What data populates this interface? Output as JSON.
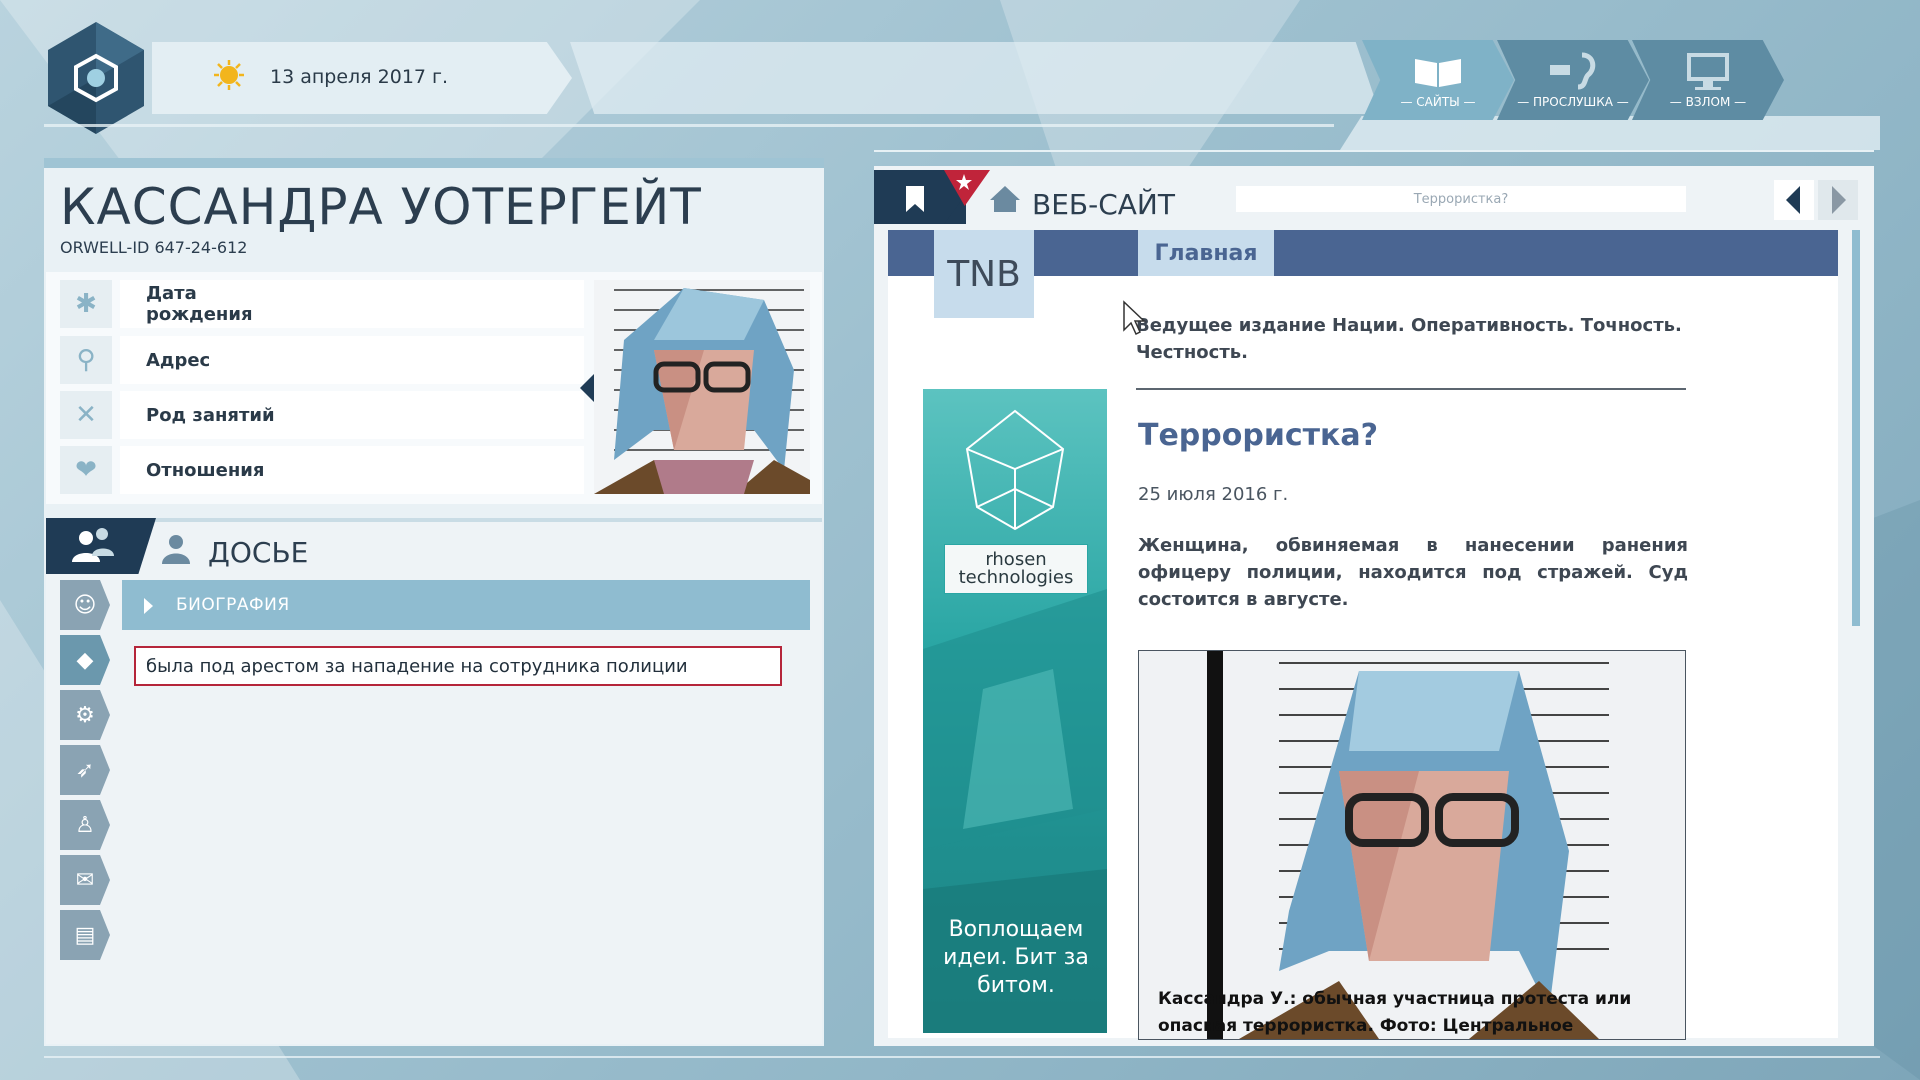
{
  "header": {
    "date": "13 апреля 2017 г.",
    "tabs": [
      {
        "label": "— САЙТЫ —",
        "icon": "book-icon",
        "active": true
      },
      {
        "label": "— ПРОСЛУШКА —",
        "icon": "ear-icon",
        "active": false
      },
      {
        "label": "— ВЗЛОМ —",
        "icon": "monitor-icon",
        "active": false
      }
    ]
  },
  "profile": {
    "name": "КАССАНДРА УОТЕРГЕЙТ",
    "orwell_id": "ORWELL-ID  647-24-612",
    "fields": [
      {
        "label": "Дата\nрождения",
        "icon": "asterisk-icon"
      },
      {
        "label": "Адрес",
        "icon": "location-pin-icon"
      },
      {
        "label": "Род занятий",
        "icon": "tools-icon"
      },
      {
        "label": "Отношения",
        "icon": "hearts-icon"
      }
    ]
  },
  "dossier": {
    "title": "ДОСЬЕ",
    "section": "БИОГРАФИЯ",
    "entry": "была под арестом за нападение на сотрудника полиции",
    "side_icons": [
      "face-icon",
      "eraser-icon",
      "gears-icon",
      "runner-icon",
      "person-icon",
      "chat-icon",
      "notebook-icon"
    ]
  },
  "browser": {
    "label": "ВЕБ-САЙТ",
    "url": "Террористка?",
    "site": {
      "logo": "TNB",
      "nav": "Главная",
      "tagline": "Ведущее издание Нации. Оперативность. Точность. Честность.",
      "headline": "Террористка?",
      "date": "25 июля 2016 г.",
      "body": "Женщина, обвиняемая в нанесении ранения офицеру полиции, находится под стражей. Суд состоится в августе.",
      "caption": "Кассандра У.: обычная участница протеста или опасная террористка. Фото: Центральное"
    },
    "ad": {
      "brand": "rhosen technologies",
      "text": "Воплощаем идеи. Бит за битом."
    }
  },
  "colors": {
    "dark": "#1f3b55",
    "accent": "#8fbcd0",
    "red": "#c0243a",
    "site_blue": "#4a6592"
  }
}
